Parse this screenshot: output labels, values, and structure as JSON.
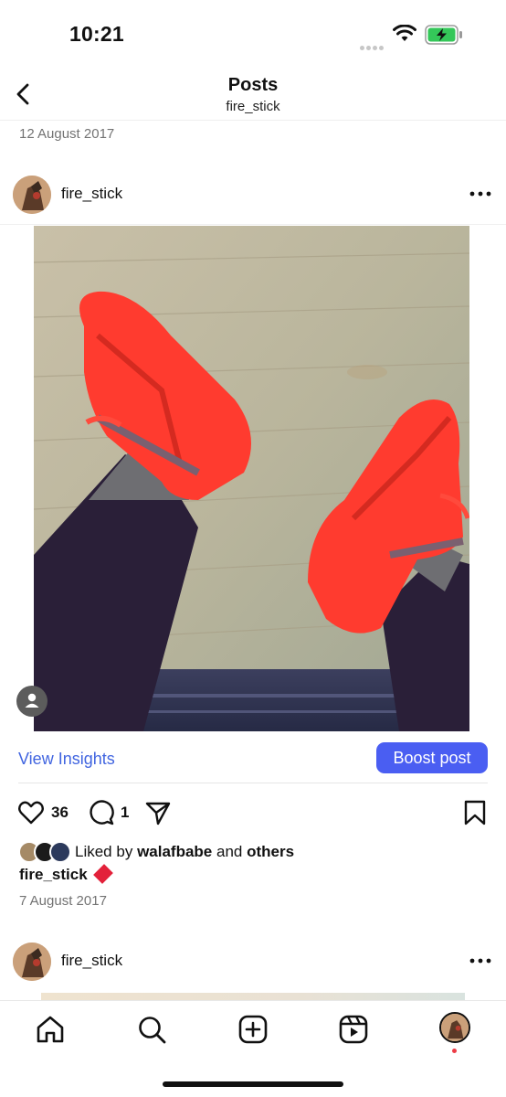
{
  "status_bar": {
    "time": "10:21"
  },
  "header": {
    "title": "Posts",
    "subtitle": "fire_stick"
  },
  "previous_post": {
    "date": "12 August 2017"
  },
  "post": {
    "username": "fire_stick",
    "view_insights_label": "View Insights",
    "boost_label": "Boost post",
    "like_count": "36",
    "comment_count": "1",
    "liked_by_prefix": "Liked by",
    "liked_by_user": "walafbabe",
    "liked_by_and": "and",
    "liked_by_others": "others",
    "caption_user": "fire_stick",
    "date": "7 August 2017"
  },
  "next_post": {
    "username": "fire_stick"
  },
  "tabs": [
    {
      "name": "home-icon"
    },
    {
      "name": "search-icon"
    },
    {
      "name": "create-icon"
    },
    {
      "name": "reels-icon"
    },
    {
      "name": "profile-avatar"
    }
  ],
  "colors": {
    "accent_link": "#4165e0",
    "boost_button": "#4a5ef2",
    "battery_green": "#34c759",
    "notification_dot": "#ed3b46",
    "sneaker_red": "#ff3b2f"
  }
}
